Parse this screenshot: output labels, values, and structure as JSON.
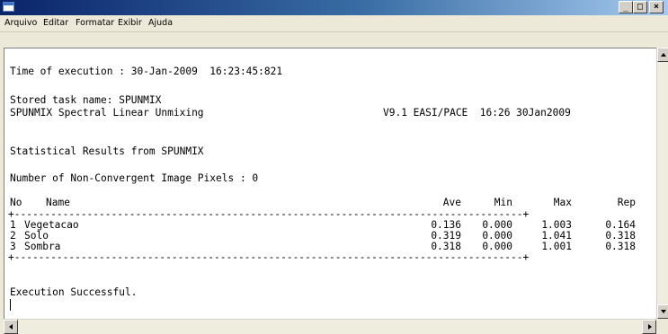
{
  "menu": {
    "items": [
      "Arquivo",
      "Editar",
      "Formatar",
      "Exibir",
      "Ajuda"
    ]
  },
  "titlebar": {
    "minimize": "_",
    "maximize": "□",
    "close": "×"
  },
  "content": {
    "execution_time": "Time of execution : 30-Jan-2009  16:23:45:821",
    "stored_task": "Stored task name: SPUNMIX",
    "task_desc": "SPUNMIX Spectral Linear Unmixing",
    "version": "V9.1 EASI/PACE  16:26 30Jan2009",
    "stats_title": "Statistical Results from SPUNMIX",
    "nonconvergent": "Number of Non-Convergent Image Pixels : 0",
    "table": {
      "headers": {
        "no": "No",
        "name": "Name",
        "ave": "Ave",
        "min": "Min",
        "max": "Max",
        "rep": "Rep"
      },
      "top_border": "+------------------------------------------------------------------------------------+",
      "bottom_border": "+------------------------------------------------------------------------------------+",
      "rows": [
        {
          "no": "1",
          "name": "Vegetacao",
          "ave": "0.136",
          "min": "0.000",
          "max": "1.003",
          "rep": "0.164"
        },
        {
          "no": "2",
          "name": "Solo",
          "ave": "0.319",
          "min": "0.000",
          "max": "1.041",
          "rep": "0.318"
        },
        {
          "no": "3",
          "name": "Sombra",
          "ave": "0.318",
          "min": "0.000",
          "max": "1.001",
          "rep": "0.318"
        }
      ]
    },
    "result": "Execution Successful."
  }
}
